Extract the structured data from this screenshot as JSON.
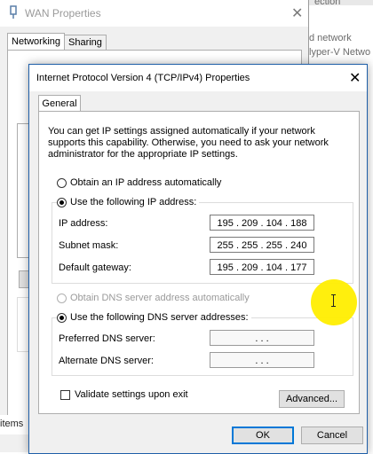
{
  "background_window": {
    "partial_text_top": "ection",
    "items": [
      {
        "line1": "d network",
        "line2": "lyper-V Netwo"
      }
    ],
    "status_items": "items"
  },
  "wan_window": {
    "title": "WAN Properties",
    "tabs": [
      {
        "label": "Networking",
        "active": true
      },
      {
        "label": "Sharing",
        "active": false
      }
    ]
  },
  "dialog": {
    "title": "Internet Protocol Version 4 (TCP/IPv4) Properties",
    "tab_general": "General",
    "info_text": "You can get IP settings assigned automatically if your network supports this capability. Otherwise, you need to ask your network administrator for the appropriate IP settings.",
    "radio_obtain_ip": "Obtain an IP address automatically",
    "radio_use_ip": "Use the following IP address:",
    "ip_label": "IP address:",
    "ip_value": "195 . 209 . 104 . 188",
    "subnet_label": "Subnet mask:",
    "subnet_value": "255 . 255 . 255 . 240",
    "gateway_label": "Default gateway:",
    "gateway_value": "195 . 209 . 104 . 177",
    "radio_obtain_dns": "Obtain DNS server address automatically",
    "radio_use_dns": "Use the following DNS server addresses:",
    "preferred_dns_label": "Preferred DNS server:",
    "preferred_dns_value": ".      .      .",
    "alternate_dns_label": "Alternate DNS server:",
    "alternate_dns_value": ".      .      .",
    "validate_label": "Validate settings upon exit",
    "advanced_button": "Advanced...",
    "ok_button": "OK",
    "cancel_button": "Cancel"
  },
  "colors": {
    "accent": "#0078d7",
    "cursor_highlight": "#ffee00"
  }
}
